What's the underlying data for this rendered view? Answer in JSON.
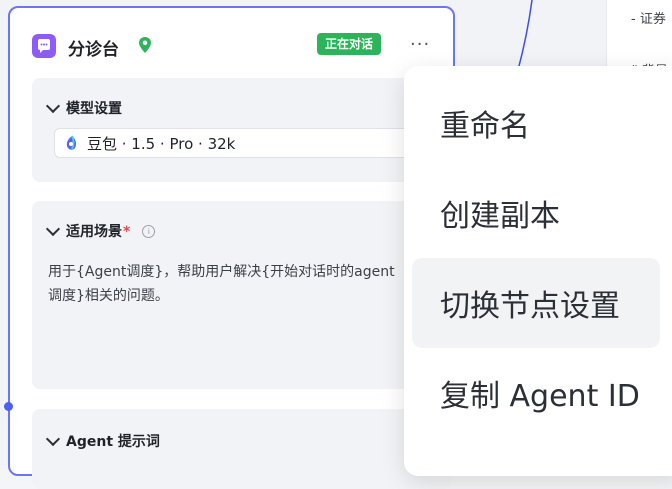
{
  "node": {
    "title": "分诊台",
    "status": "正在对话",
    "more": "···"
  },
  "model_settings": {
    "heading": "模型设置",
    "selected_model": "豆包 · 1.5 · Pro · 32k"
  },
  "scene": {
    "heading": "适用场景",
    "required_mark": "*",
    "description": "用于{Agent调度}，帮助用户解决{开始对话时的agent调度}相关的问题。"
  },
  "prompt": {
    "heading": "Agent 提示词"
  },
  "side_card": {
    "line1": "- 证券",
    "line2": "“ 背景"
  },
  "menu": {
    "items": [
      {
        "label": "重命名"
      },
      {
        "label": "创建副本"
      },
      {
        "label": "切换节点设置"
      },
      {
        "label": "复制 Agent ID"
      }
    ]
  },
  "colors": {
    "accent": "#6b76f0",
    "status_green": "#2bb45a",
    "node_icon": "#8e5cf5",
    "pin_green": "#2bb45a"
  },
  "icons": [
    "chat-bubble-icon",
    "location-pin-icon",
    "more-icon",
    "chevron-down-icon",
    "info-icon",
    "doubao-logo-icon"
  ]
}
